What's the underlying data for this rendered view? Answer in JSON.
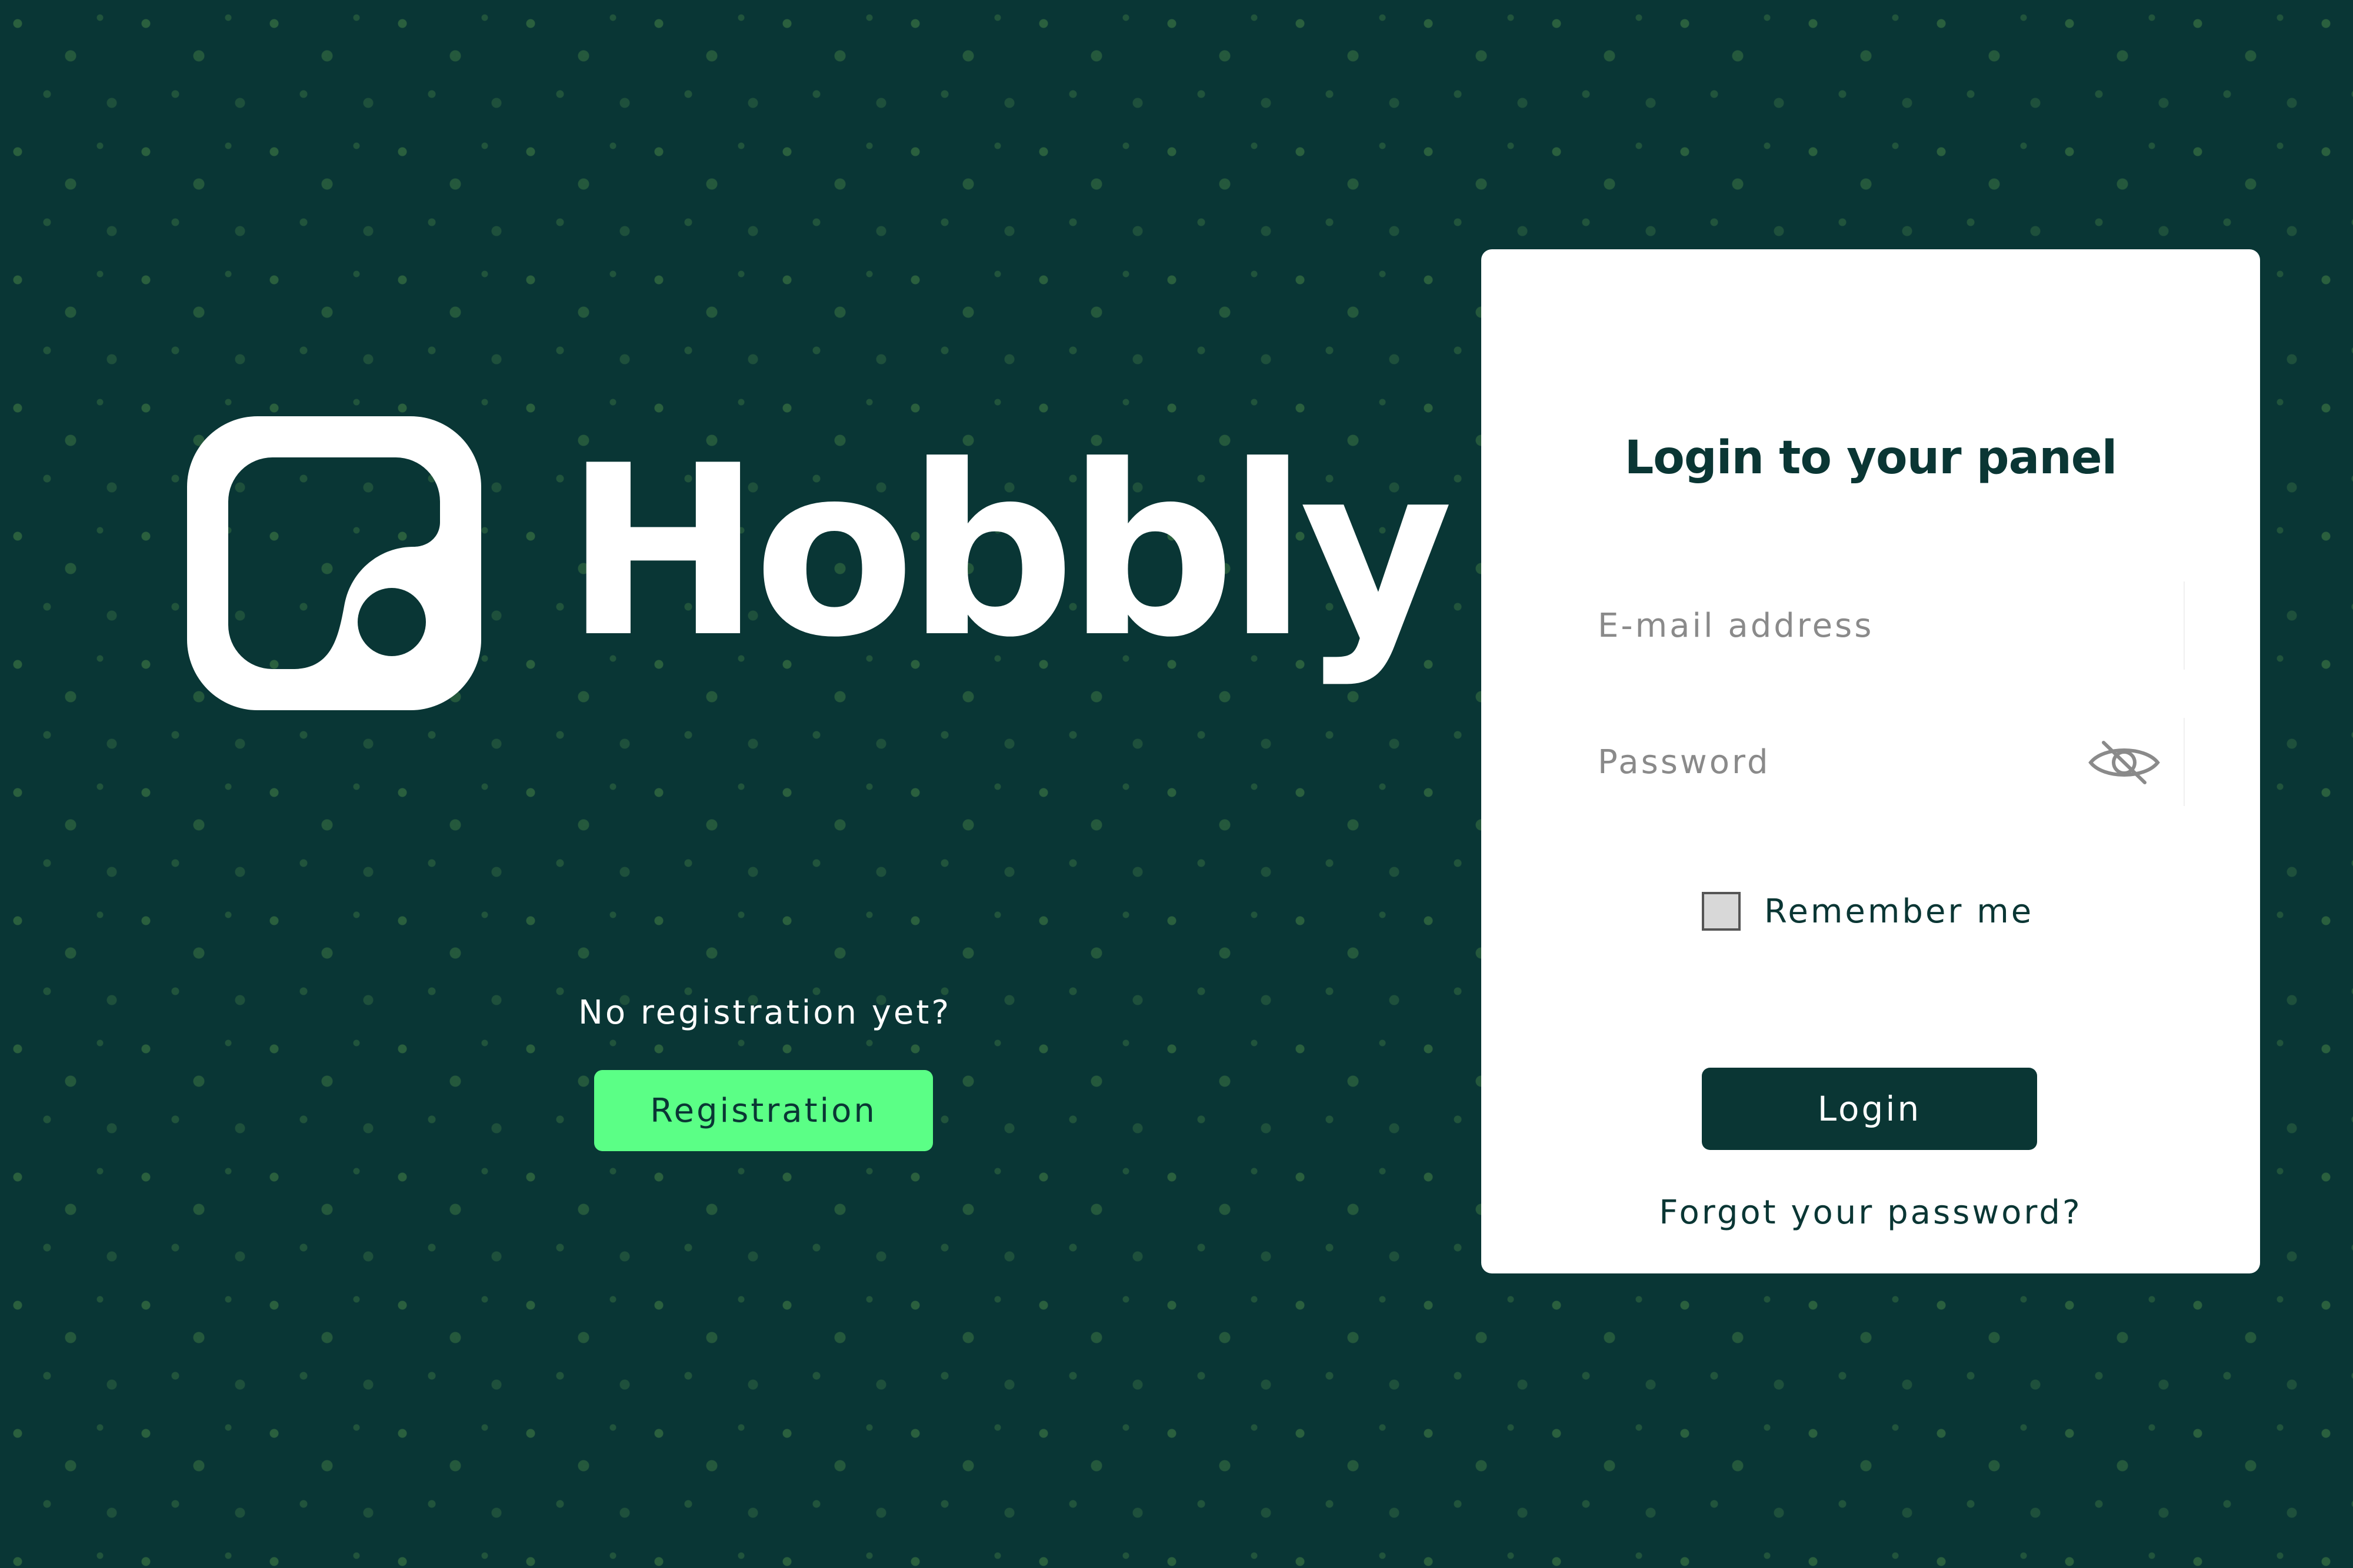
{
  "brand": {
    "name": "Hobbly",
    "logo_icon": "hobbly-logo-icon"
  },
  "registration": {
    "prompt": "No registration yet?",
    "button_label": "Registration"
  },
  "login_card": {
    "title": "Login to your panel",
    "email": {
      "placeholder": "E-mail address",
      "value": ""
    },
    "password": {
      "placeholder": "Password",
      "value": "",
      "visibility_icon": "eye-slash-icon"
    },
    "remember_me": {
      "label": "Remember me",
      "checked": false
    },
    "login_button_label": "Login",
    "forgot_password_label": "Forgot your password?"
  },
  "colors": {
    "background": "#093635",
    "pattern": "#3f7a3f",
    "card": "#ffffff",
    "primary": "#0a3634",
    "accent": "#5bff86"
  }
}
